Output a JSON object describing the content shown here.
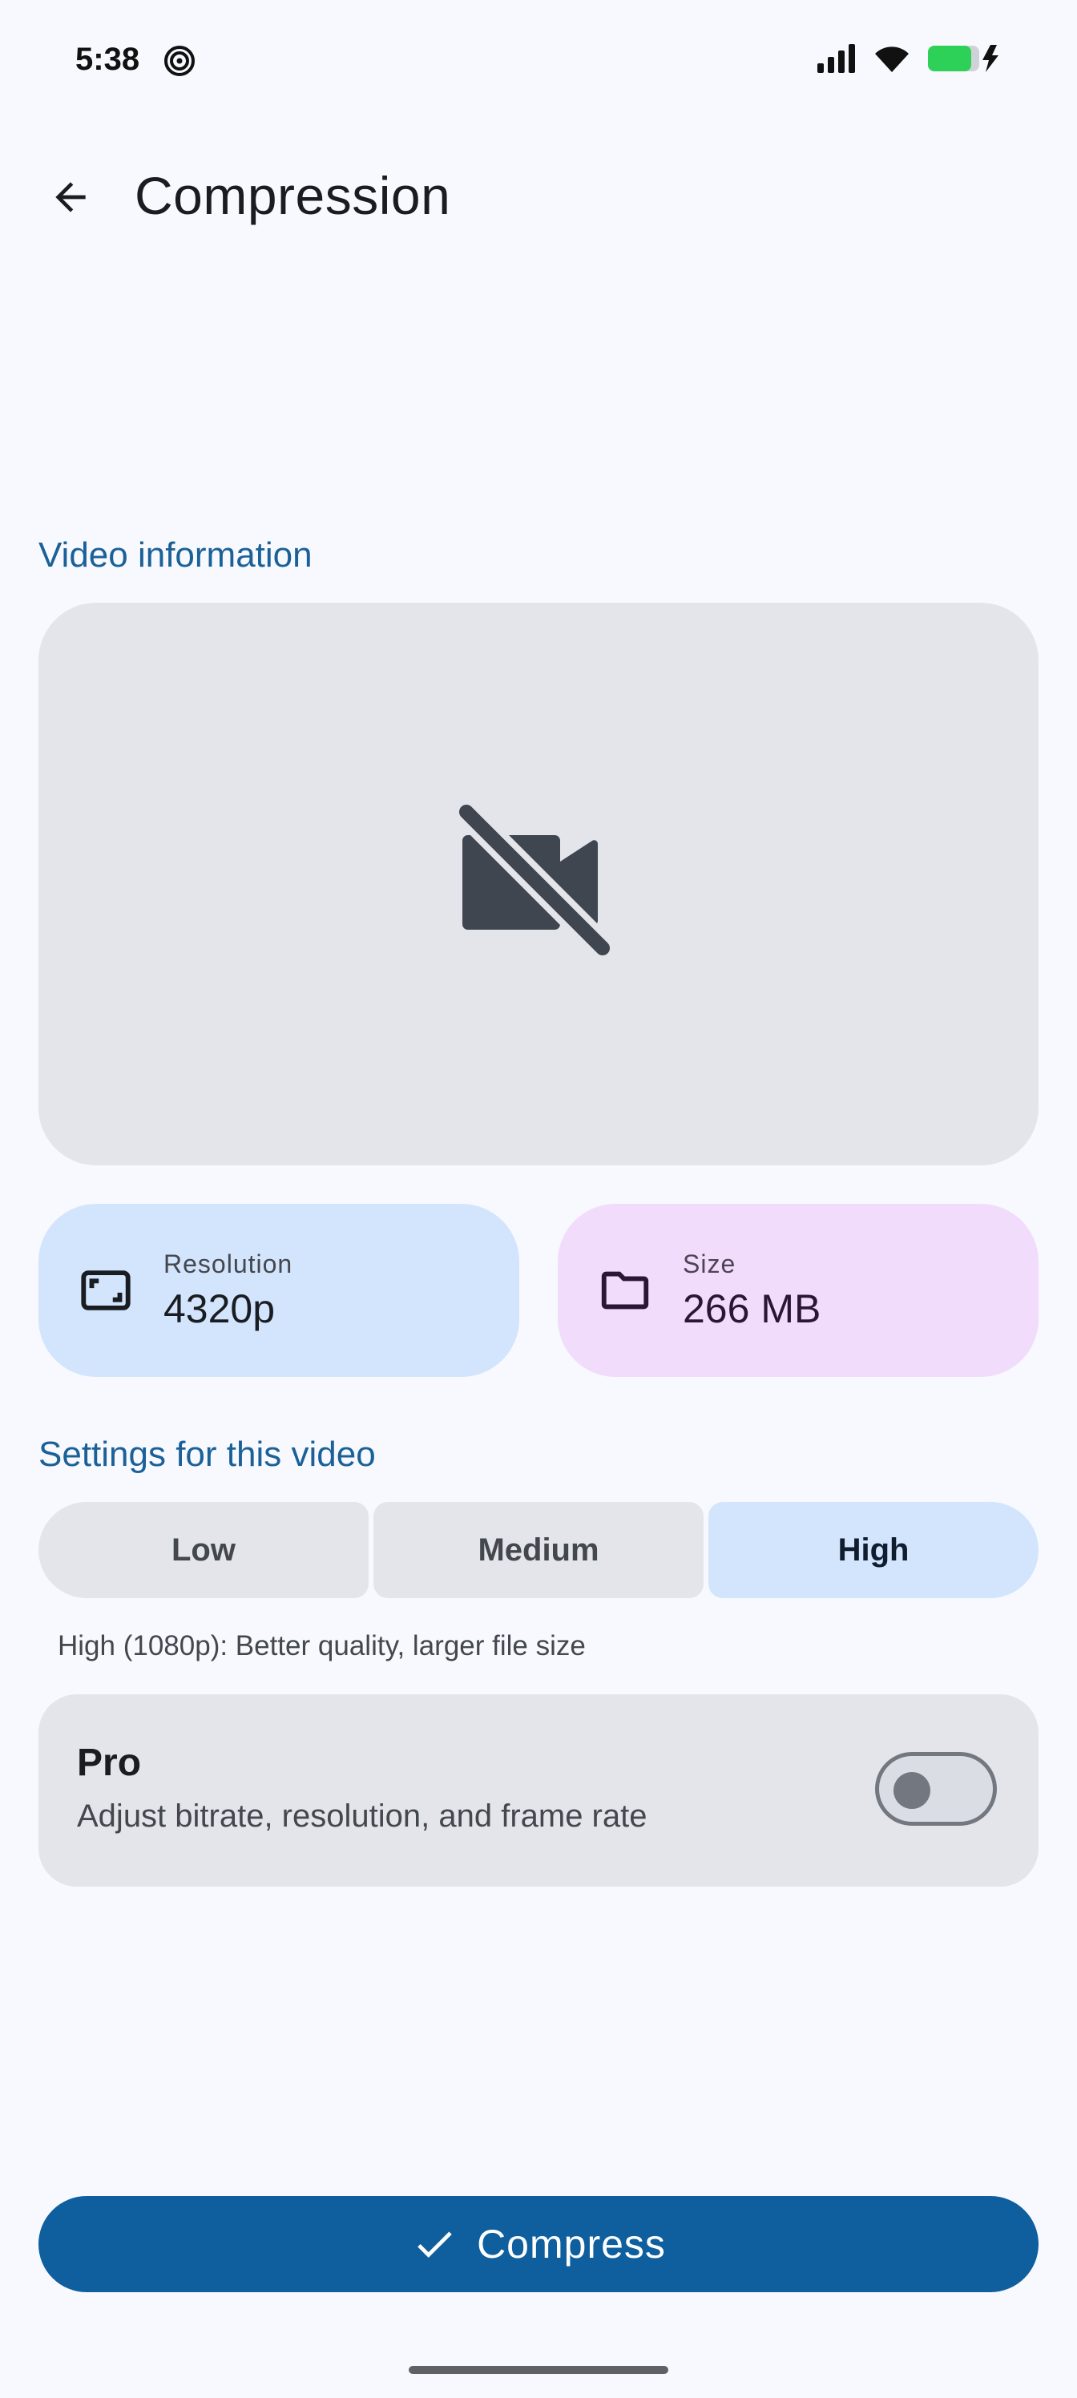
{
  "status": {
    "time": "5:38"
  },
  "header": {
    "title": "Compression"
  },
  "video_info": {
    "section_title": "Video information",
    "resolution_label": "Resolution",
    "resolution_value": "4320p",
    "size_label": "Size",
    "size_value": "266 MB"
  },
  "settings": {
    "section_title": "Settings for this video",
    "options": [
      "Low",
      "Medium",
      "High"
    ],
    "selected": "High",
    "description": "High (1080p): Better quality, larger file size"
  },
  "pro": {
    "title": "Pro",
    "subtitle": "Adjust bitrate, resolution, and frame rate",
    "enabled": false
  },
  "action": {
    "label": "Compress"
  },
  "icons": {
    "back": "arrow-back-icon",
    "preview": "videocam-off-icon",
    "resolution": "aspect-ratio-icon",
    "size": "folder-icon",
    "compress": "check-icon"
  },
  "colors": {
    "accent": "#0f5f9f",
    "section": "#1b6198",
    "selected_segment": "#d3e4fd",
    "size_card": "#f2dcfb"
  }
}
